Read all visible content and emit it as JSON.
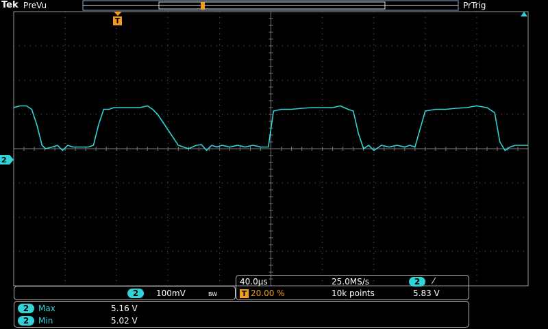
{
  "header": {
    "brand": "Tek",
    "acq_mode": "PreVu",
    "trigger_status": "PrTrig"
  },
  "markers": {
    "trigger_point": "T",
    "channel_ref": "2"
  },
  "colors": {
    "trace": "#2fd3d8",
    "trigger": "#f39b1f",
    "grid": "#7a7a7a",
    "background": "#000000"
  },
  "channel_panel": {
    "channel": "2",
    "scale": "100mV",
    "bw_limit": "BW"
  },
  "timebase_panel": {
    "time_per_div": "40.0μs",
    "sample_rate": "25.0MS/s",
    "trigger_channel": "2",
    "trigger_slope": "⁄",
    "trigger_icon": "T",
    "trigger_position": "20.00 %",
    "record_length": "10k points",
    "trigger_level": "5.83 V"
  },
  "measurements": [
    {
      "channel": "2",
      "label": "Max",
      "value": "5.16 V"
    },
    {
      "channel": "2",
      "label": "Min",
      "value": "5.02 V"
    }
  ],
  "chart_data": {
    "type": "line",
    "title": "",
    "xlabel": "",
    "ylabel": "",
    "x_unit_per_div": "40.0μs",
    "y_unit_per_div": "100mV",
    "divisions": {
      "x": 10,
      "y": 8
    },
    "xlim_div": [
      0,
      10
    ],
    "ylim_div": [
      -4,
      4
    ],
    "grid": true,
    "series": [
      {
        "x": [
          0,
          0.12,
          0.25,
          0.35,
          0.45,
          0.55,
          0.62,
          0.75,
          0.85,
          0.95,
          1.05,
          1.15,
          1.3,
          1.45,
          1.55,
          1.65,
          1.75,
          1.85,
          1.95,
          2.05,
          2.15,
          2.3,
          2.45,
          2.6,
          2.7,
          2.8,
          3.0,
          3.2,
          3.4,
          3.55,
          3.65,
          3.75,
          3.85,
          3.95,
          4.05,
          4.2,
          4.35,
          4.5,
          4.65,
          4.8,
          4.95,
          5.05,
          5.2,
          5.4,
          5.6,
          5.8,
          6.0,
          6.2,
          6.35,
          6.5,
          6.6,
          6.7,
          6.8,
          6.9,
          7.0,
          7.15,
          7.3,
          7.45,
          7.6,
          7.7,
          7.8,
          8.0,
          8.2,
          8.4,
          8.6,
          8.8,
          9.0,
          9.2,
          9.35,
          9.45,
          9.55,
          9.65,
          9.75,
          9.85,
          10.0
        ],
        "y": [
          1.2,
          1.25,
          1.25,
          1.15,
          0.7,
          0.1,
          0.0,
          0.05,
          0.1,
          -0.05,
          0.1,
          0.05,
          0.05,
          0.05,
          0.1,
          0.7,
          1.15,
          1.15,
          1.2,
          1.2,
          1.2,
          1.2,
          1.2,
          1.25,
          1.15,
          1.0,
          0.55,
          0.1,
          0.0,
          0.1,
          0.12,
          -0.05,
          0.1,
          0.05,
          0.1,
          0.05,
          0.1,
          0.05,
          0.1,
          0.05,
          0.05,
          1.1,
          1.15,
          1.15,
          1.18,
          1.2,
          1.2,
          1.2,
          1.25,
          1.15,
          1.1,
          0.45,
          0.0,
          0.1,
          -0.05,
          0.1,
          0.05,
          0.1,
          0.05,
          0.1,
          0.05,
          1.1,
          1.15,
          1.15,
          1.18,
          1.2,
          1.25,
          1.2,
          1.05,
          0.2,
          -0.05,
          0.05,
          0.1,
          0.1,
          0.1
        ]
      }
    ]
  }
}
